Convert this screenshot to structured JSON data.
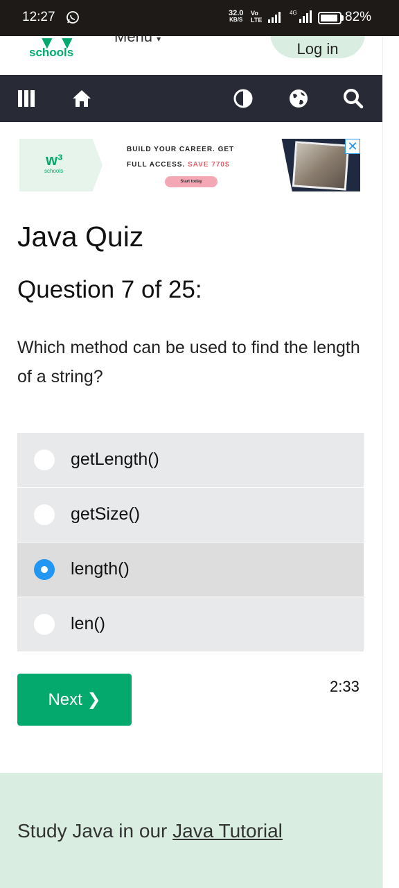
{
  "statusbar": {
    "time": "12:27",
    "speed_value": "32.0",
    "speed_unit": "KB/S",
    "volte": "Vo LTE",
    "network": "4G",
    "battery": "82%"
  },
  "topnav": {
    "logo_text": "schools",
    "menu_label": "Menu",
    "login_label": "Log in"
  },
  "toolbar": {
    "icons": [
      "menu-icon",
      "home-icon",
      "contrast-icon",
      "globe-icon",
      "search-icon"
    ]
  },
  "ad": {
    "logo_small": "schools",
    "line1": "BUILD YOUR CAREER. GET",
    "line2_start": "FULL ACCESS.",
    "line2_highlight": "SAVE 770$",
    "cta": "Start today",
    "close_symbol": "✕"
  },
  "quiz": {
    "title": "Java Quiz",
    "question_number": "Question 7 of 25:",
    "question_text": "Which method can be used to find the length of a string?",
    "options": [
      {
        "label": "getLength()",
        "selected": false
      },
      {
        "label": "getSize()",
        "selected": false
      },
      {
        "label": "length()",
        "selected": true
      },
      {
        "label": "len()",
        "selected": false
      }
    ],
    "next_label": "Next ❯",
    "timer": "2:33"
  },
  "study": {
    "prefix": "Study Java in our ",
    "link": "Java Tutorial"
  },
  "colors": {
    "brand_green": "#04aa6d",
    "toolbar_bg": "#282a35",
    "radio_selected": "#2196f3",
    "option_bg": "#e7e9eb",
    "study_bg": "#d9eee1"
  }
}
